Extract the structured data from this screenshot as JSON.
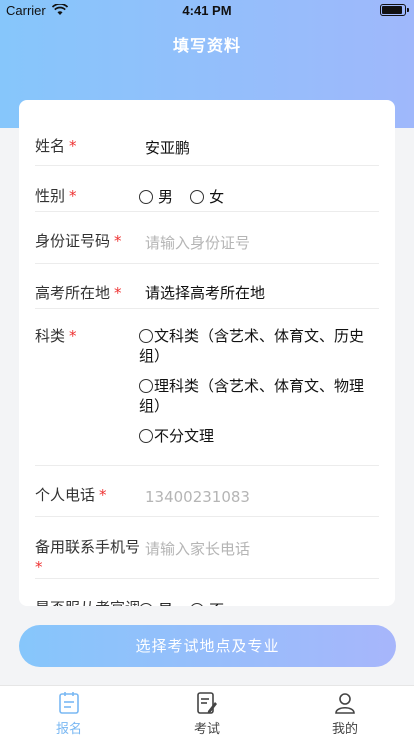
{
  "status": {
    "carrier": "Carrier",
    "time": "4:41 PM"
  },
  "header": {
    "title": "填写资料"
  },
  "form": {
    "name": {
      "label": "姓名",
      "required": "*",
      "value": "安亚鹏"
    },
    "gender": {
      "label": "性别",
      "required": "*",
      "options": [
        "男",
        "女"
      ]
    },
    "id_number": {
      "label": "身份证号码",
      "required": "*",
      "placeholder": "请输入身份证号"
    },
    "exam_location": {
      "label": "高考所在地",
      "required": "*",
      "value": "请选择高考所在地"
    },
    "subject": {
      "label": "科类",
      "required": "*",
      "options": [
        "文科类（含艺术、体育文、历史组）",
        "理科类（含艺术、体育文、物理组）",
        "不分文理"
      ]
    },
    "phone": {
      "label": "个人电话",
      "required": "*",
      "placeholder": "13400231083"
    },
    "backup_phone": {
      "label": "备用联系手机号",
      "required": "*",
      "placeholder": "请输入家长电话"
    },
    "partial_row": {
      "label": "是否服从考官调",
      "options": [
        "是",
        "否"
      ]
    }
  },
  "action": {
    "label": "选择考试地点及专业"
  },
  "tabbar": {
    "tabs": [
      {
        "label": "报名"
      },
      {
        "label": "考试"
      },
      {
        "label": "我的"
      }
    ],
    "active_color": "#7ab8f3"
  }
}
